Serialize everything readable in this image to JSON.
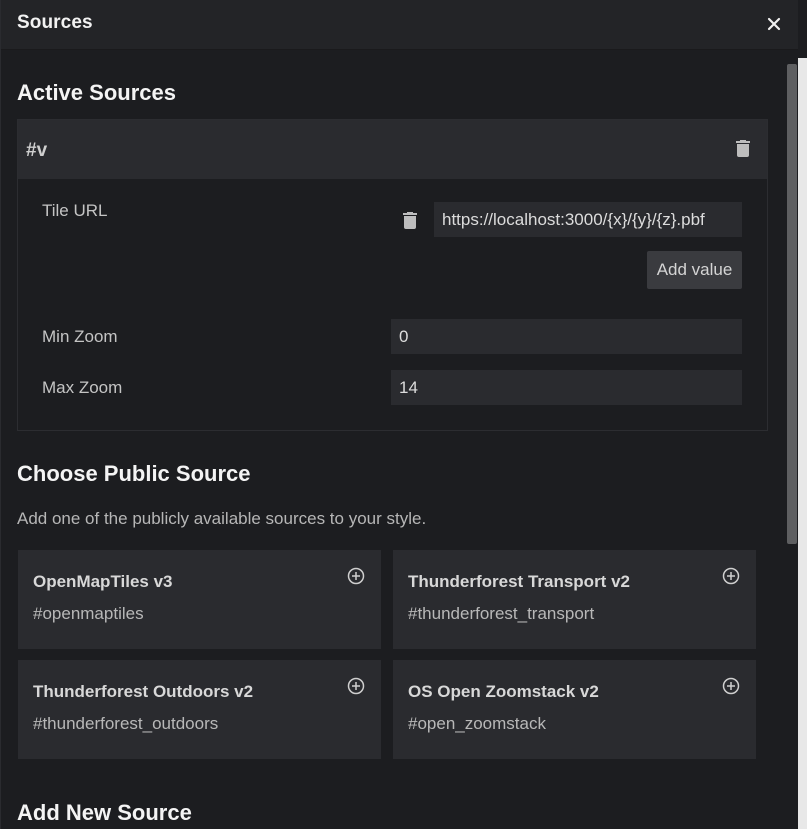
{
  "header": {
    "title": "Sources"
  },
  "active_sources": {
    "heading": "Active Sources",
    "source": {
      "id": "#v",
      "tile_url_label": "Tile URL",
      "tile_url_value": "https://localhost:3000/{x}/{y}/{z}.pbf",
      "add_value_label": "Add value",
      "min_zoom_label": "Min Zoom",
      "min_zoom_value": "0",
      "max_zoom_label": "Max Zoom",
      "max_zoom_value": "14"
    }
  },
  "public_sources": {
    "heading": "Choose Public Source",
    "description": "Add one of the publicly available sources to your style.",
    "items": [
      {
        "title": "OpenMapTiles v3",
        "id": "#openmaptiles"
      },
      {
        "title": "Thunderforest Transport v2",
        "id": "#thunderforest_transport"
      },
      {
        "title": "Thunderforest Outdoors v2",
        "id": "#thunderforest_outdoors"
      },
      {
        "title": "OS Open Zoomstack v2",
        "id": "#open_zoomstack"
      }
    ]
  },
  "new_source": {
    "heading": "Add New Source"
  },
  "icons": {
    "close": "close-icon",
    "delete": "trash-icon",
    "add": "plus-circle-icon"
  }
}
